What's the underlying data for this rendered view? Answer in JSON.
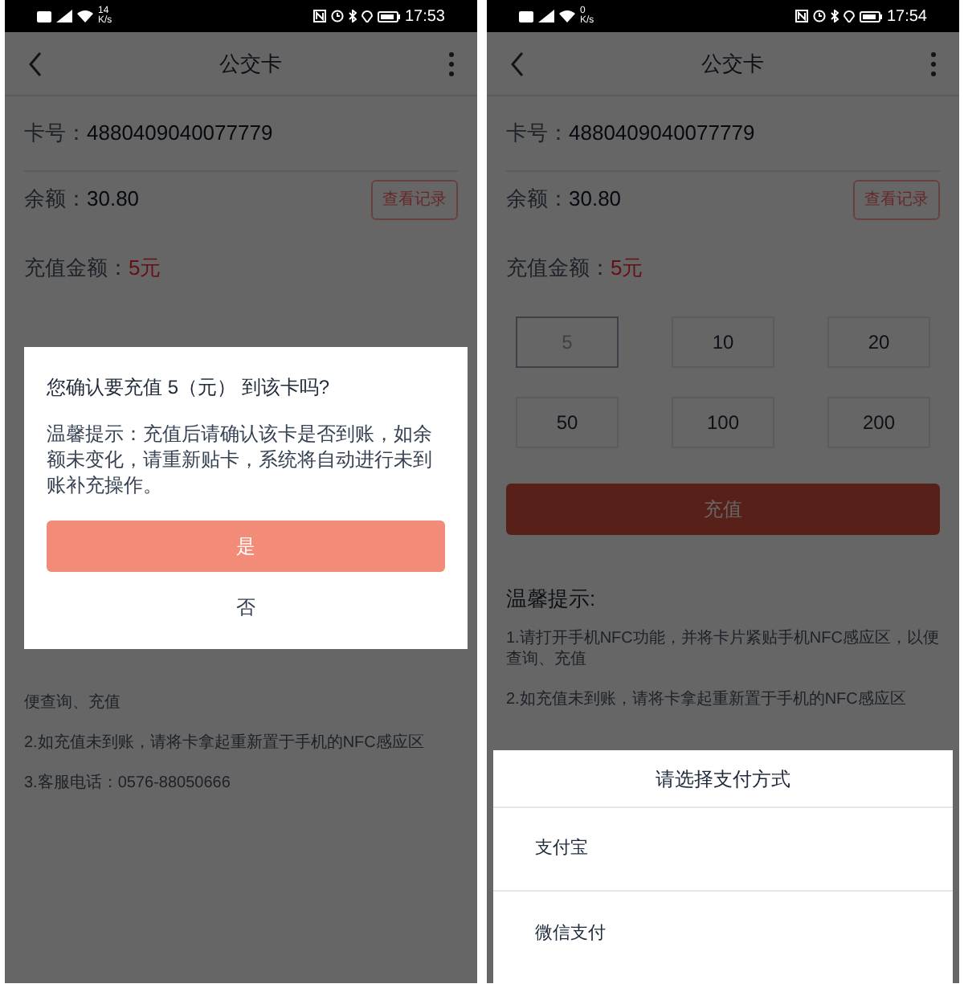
{
  "phones": [
    {
      "status_bar": {
        "speed": "14",
        "speed_unit": "K/s",
        "time": "17:53"
      },
      "title": "公交卡",
      "card_label": "卡号：",
      "card_number": "4880409040077779",
      "balance_label": "余额：",
      "balance": "30.80",
      "records_button": "查看记录",
      "amount_label": "充值金额：",
      "amount": "5元",
      "tips": [
        "便查询、充值",
        "2.如充值未到账，请将卡拿起重新置于手机的NFC感应区",
        "3.客服电话：0576-88050666"
      ],
      "overlay": {
        "kind": "dialog",
        "question": "您确认要充值 5（元） 到该卡吗?",
        "message": "温馨提示：充值后请确认该卡是否到账，如余额未变化，请重新贴卡，系统将自动进行未到账补充操作。",
        "confirm": "是",
        "cancel": "否"
      }
    },
    {
      "status_bar": {
        "speed": "0",
        "speed_unit": "K/s",
        "time": "17:54"
      },
      "title": "公交卡",
      "card_label": "卡号：",
      "card_number": "4880409040077779",
      "balance_label": "余额：",
      "balance": "30.80",
      "records_button": "查看记录",
      "amount_label": "充值金额：",
      "amount": "5元",
      "amounts": [
        {
          "label": "5",
          "selected": true
        },
        {
          "label": "10",
          "selected": false
        },
        {
          "label": "20",
          "selected": false
        },
        {
          "label": "50",
          "selected": false
        },
        {
          "label": "100",
          "selected": false
        },
        {
          "label": "200",
          "selected": false
        }
      ],
      "recharge_button": "充值",
      "tips_title": "温馨提示:",
      "tips": [
        "1.请打开手机NFC功能，并将卡片紧贴手机NFC感应区，以便查询、充值",
        "2.如充值未到账，请将卡拿起重新置于手机的NFC感应区"
      ],
      "overlay": {
        "kind": "sheet",
        "title": "请选择支付方式",
        "options": [
          "支付宝",
          "微信支付"
        ]
      }
    }
  ]
}
